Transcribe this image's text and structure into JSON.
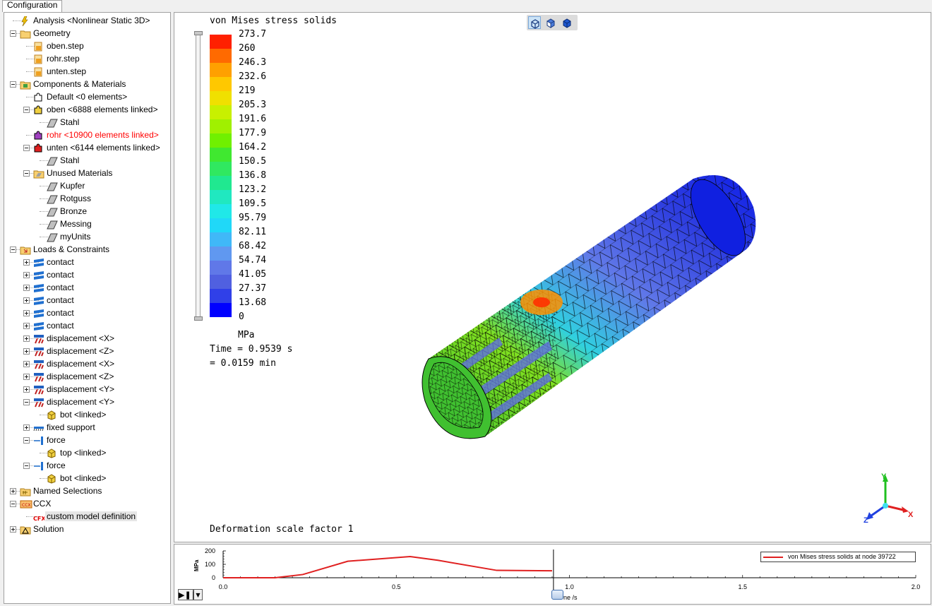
{
  "tabs": [
    "Configuration"
  ],
  "tree": [
    {
      "label": "Analysis <Nonlinear Static 3D>",
      "level": 0,
      "icon": "analysis-icon",
      "expander": "none"
    },
    {
      "label": "Geometry",
      "level": 0,
      "icon": "folder-icon",
      "expander": "minus"
    },
    {
      "label": "oben.step",
      "level": 1,
      "icon": "step-file-icon",
      "expander": "none"
    },
    {
      "label": "rohr.step",
      "level": 1,
      "icon": "step-file-icon",
      "expander": "none"
    },
    {
      "label": "unten.step",
      "level": 1,
      "icon": "step-file-icon",
      "expander": "none"
    },
    {
      "label": "Components & Materials",
      "level": 0,
      "icon": "components-folder-icon",
      "expander": "minus"
    },
    {
      "label": "Default <0 elements>",
      "level": 1,
      "icon": "puzzle-white-icon",
      "expander": "none"
    },
    {
      "label": "oben <6888 elements linked>",
      "level": 1,
      "icon": "puzzle-yellow-icon",
      "expander": "minus"
    },
    {
      "label": "Stahl",
      "level": 2,
      "icon": "material-icon",
      "expander": "none"
    },
    {
      "label": "rohr <10900 elements linked>",
      "level": 1,
      "icon": "puzzle-purple-icon",
      "expander": "none",
      "color": "red"
    },
    {
      "label": "unten <6144 elements linked>",
      "level": 1,
      "icon": "puzzle-red-icon",
      "expander": "minus"
    },
    {
      "label": "Stahl",
      "level": 2,
      "icon": "material-icon",
      "expander": "none"
    },
    {
      "label": "Unused Materials",
      "level": 1,
      "icon": "materials-folder-icon",
      "expander": "minus"
    },
    {
      "label": "Kupfer",
      "level": 2,
      "icon": "material-icon",
      "expander": "none"
    },
    {
      "label": "Rotguss",
      "level": 2,
      "icon": "material-icon",
      "expander": "none"
    },
    {
      "label": "Bronze",
      "level": 2,
      "icon": "material-icon",
      "expander": "none"
    },
    {
      "label": "Messing",
      "level": 2,
      "icon": "material-icon",
      "expander": "none"
    },
    {
      "label": "myUnits",
      "level": 2,
      "icon": "material-icon",
      "expander": "none"
    },
    {
      "label": "Loads & Constraints",
      "level": 0,
      "icon": "loads-folder-icon",
      "expander": "minus"
    },
    {
      "label": "contact",
      "level": 1,
      "icon": "contact-icon",
      "expander": "plus"
    },
    {
      "label": "contact",
      "level": 1,
      "icon": "contact-icon",
      "expander": "plus"
    },
    {
      "label": "contact",
      "level": 1,
      "icon": "contact-icon",
      "expander": "plus"
    },
    {
      "label": "contact",
      "level": 1,
      "icon": "contact-icon",
      "expander": "plus"
    },
    {
      "label": "contact",
      "level": 1,
      "icon": "contact-icon",
      "expander": "plus"
    },
    {
      "label": "contact",
      "level": 1,
      "icon": "contact-icon",
      "expander": "plus"
    },
    {
      "label": "displacement <X>",
      "level": 1,
      "icon": "displacement-icon",
      "expander": "plus"
    },
    {
      "label": "displacement <Z>",
      "level": 1,
      "icon": "displacement-icon",
      "expander": "plus"
    },
    {
      "label": "displacement <X>",
      "level": 1,
      "icon": "displacement-icon",
      "expander": "plus"
    },
    {
      "label": "displacement <Z>",
      "level": 1,
      "icon": "displacement-icon",
      "expander": "plus"
    },
    {
      "label": "displacement <Y>",
      "level": 1,
      "icon": "displacement-icon",
      "expander": "plus"
    },
    {
      "label": "displacement <Y>",
      "level": 1,
      "icon": "displacement-icon",
      "expander": "minus"
    },
    {
      "label": "bot <linked>",
      "level": 2,
      "icon": "linked-box-icon",
      "expander": "none"
    },
    {
      "label": "fixed support",
      "level": 1,
      "icon": "fixed-support-icon",
      "expander": "plus"
    },
    {
      "label": "force",
      "level": 1,
      "icon": "force-icon",
      "expander": "minus"
    },
    {
      "label": "top <linked>",
      "level": 2,
      "icon": "linked-box-icon",
      "expander": "none"
    },
    {
      "label": "force",
      "level": 1,
      "icon": "force-icon",
      "expander": "minus"
    },
    {
      "label": "bot <linked>",
      "level": 2,
      "icon": "linked-box-icon",
      "expander": "none"
    },
    {
      "label": "Named Selections",
      "level": 0,
      "icon": "named-selections-icon",
      "expander": "plus"
    },
    {
      "label": "CCX",
      "level": 0,
      "icon": "ccx-icon",
      "expander": "minus"
    },
    {
      "label": "custom model definition",
      "level": 1,
      "icon": "cfx-icon",
      "expander": "none",
      "selected": true
    },
    {
      "label": "Solution",
      "level": 0,
      "icon": "solution-icon",
      "expander": "plus"
    }
  ],
  "viewport": {
    "title": "von Mises stress solids",
    "unit": "MPa",
    "time_line1": "Time = 0.9539 s",
    "time_line2": "= 0.0159 min",
    "deformation": "Deformation scale factor 1",
    "view_buttons": [
      "wireframe-cube-icon",
      "shaded-cube-icon",
      "solid-cube-icon"
    ],
    "colorbar": {
      "labels": [
        "273.7",
        "260",
        "246.3",
        "232.6",
        "219",
        "205.3",
        "191.6",
        "177.9",
        "164.2",
        "150.5",
        "136.8",
        "123.2",
        "109.5",
        "95.79",
        "82.11",
        "68.42",
        "54.74",
        "41.05",
        "27.37",
        "13.68",
        "0"
      ],
      "colors": [
        "#ff2000",
        "#ff6a00",
        "#ffa000",
        "#ffc800",
        "#f0e000",
        "#c8f000",
        "#a0f000",
        "#70f000",
        "#40e830",
        "#30e860",
        "#20e890",
        "#20e8c0",
        "#20e8e8",
        "#20d8f8",
        "#40b8f8",
        "#6098f0",
        "#6078e8",
        "#5060e0",
        "#3040e8",
        "#0000ff"
      ]
    },
    "triad": {
      "x": "X",
      "y": "Y",
      "z": "Z"
    },
    "colors": {
      "mesh_edge": "#000000",
      "background": "#ffffff"
    }
  },
  "plot": {
    "legend": "von Mises stress solids at node 39722",
    "y_axis_label": "MPa",
    "x_axis_label": "ne /s",
    "current_time": 0.9539,
    "chart_data": {
      "type": "line",
      "series": [
        {
          "name": "von Mises stress solids at node 39722",
          "x": [
            0.0,
            0.15,
            0.23,
            0.36,
            0.54,
            0.62,
            0.79,
            0.95
          ],
          "y": [
            0,
            0,
            24,
            123,
            158,
            130,
            55,
            52
          ]
        }
      ],
      "xlim": [
        0,
        2
      ],
      "ylim": [
        0,
        200
      ],
      "x_ticks": [
        "0.0",
        "0.5",
        "1.0",
        "1.5",
        "2.0"
      ],
      "y_ticks": [
        "200",
        "100",
        "0"
      ],
      "line_color": "#e02020"
    }
  }
}
